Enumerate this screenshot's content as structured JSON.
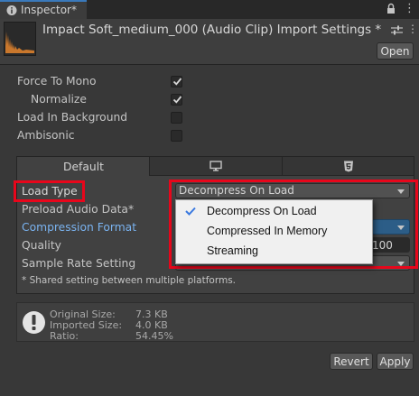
{
  "tab": {
    "label": "Inspector*",
    "lock_icon": "lock-icon",
    "menu_icon": "kebab-icon"
  },
  "header": {
    "title": "Impact Soft_medium_000 (Audio Clip) Import Settings *",
    "open_label": "Open"
  },
  "settings": {
    "force_to_mono": {
      "label": "Force To Mono",
      "checked": true
    },
    "normalize": {
      "label": "Normalize",
      "checked": true
    },
    "load_in_background": {
      "label": "Load In Background",
      "checked": false
    },
    "ambisonic": {
      "label": "Ambisonic",
      "checked": false
    }
  },
  "platform_tabs": [
    {
      "label": "Default",
      "icon": null,
      "active": true
    },
    {
      "label": "",
      "icon": "monitor-icon",
      "active": false
    },
    {
      "label": "",
      "icon": "html5-icon",
      "active": false
    }
  ],
  "platform": {
    "load_type": {
      "label": "Load Type",
      "value": "Decompress On Load"
    },
    "preload": {
      "label": "Preload Audio Data*"
    },
    "compression_format": {
      "label": "Compression Format"
    },
    "quality": {
      "label": "Quality",
      "value": "100"
    },
    "sample_rate": {
      "label": "Sample Rate Setting"
    },
    "note": "* Shared setting between multiple platforms."
  },
  "popup": {
    "items": [
      {
        "label": "Decompress On Load",
        "selected": true
      },
      {
        "label": "Compressed In Memory",
        "selected": false
      },
      {
        "label": "Streaming",
        "selected": false
      }
    ]
  },
  "info": {
    "original_label": "Original Size:",
    "original_value": "7.3 KB",
    "imported_label": "Imported Size:",
    "imported_value": "4.0 KB",
    "ratio_label": "Ratio:",
    "ratio_value": "54.45%"
  },
  "buttons": {
    "revert": "Revert",
    "apply": "Apply"
  },
  "colors": {
    "highlight_red": "#e8061b",
    "link_blue": "#7ab3f0",
    "check_blue": "#3a79e0"
  }
}
